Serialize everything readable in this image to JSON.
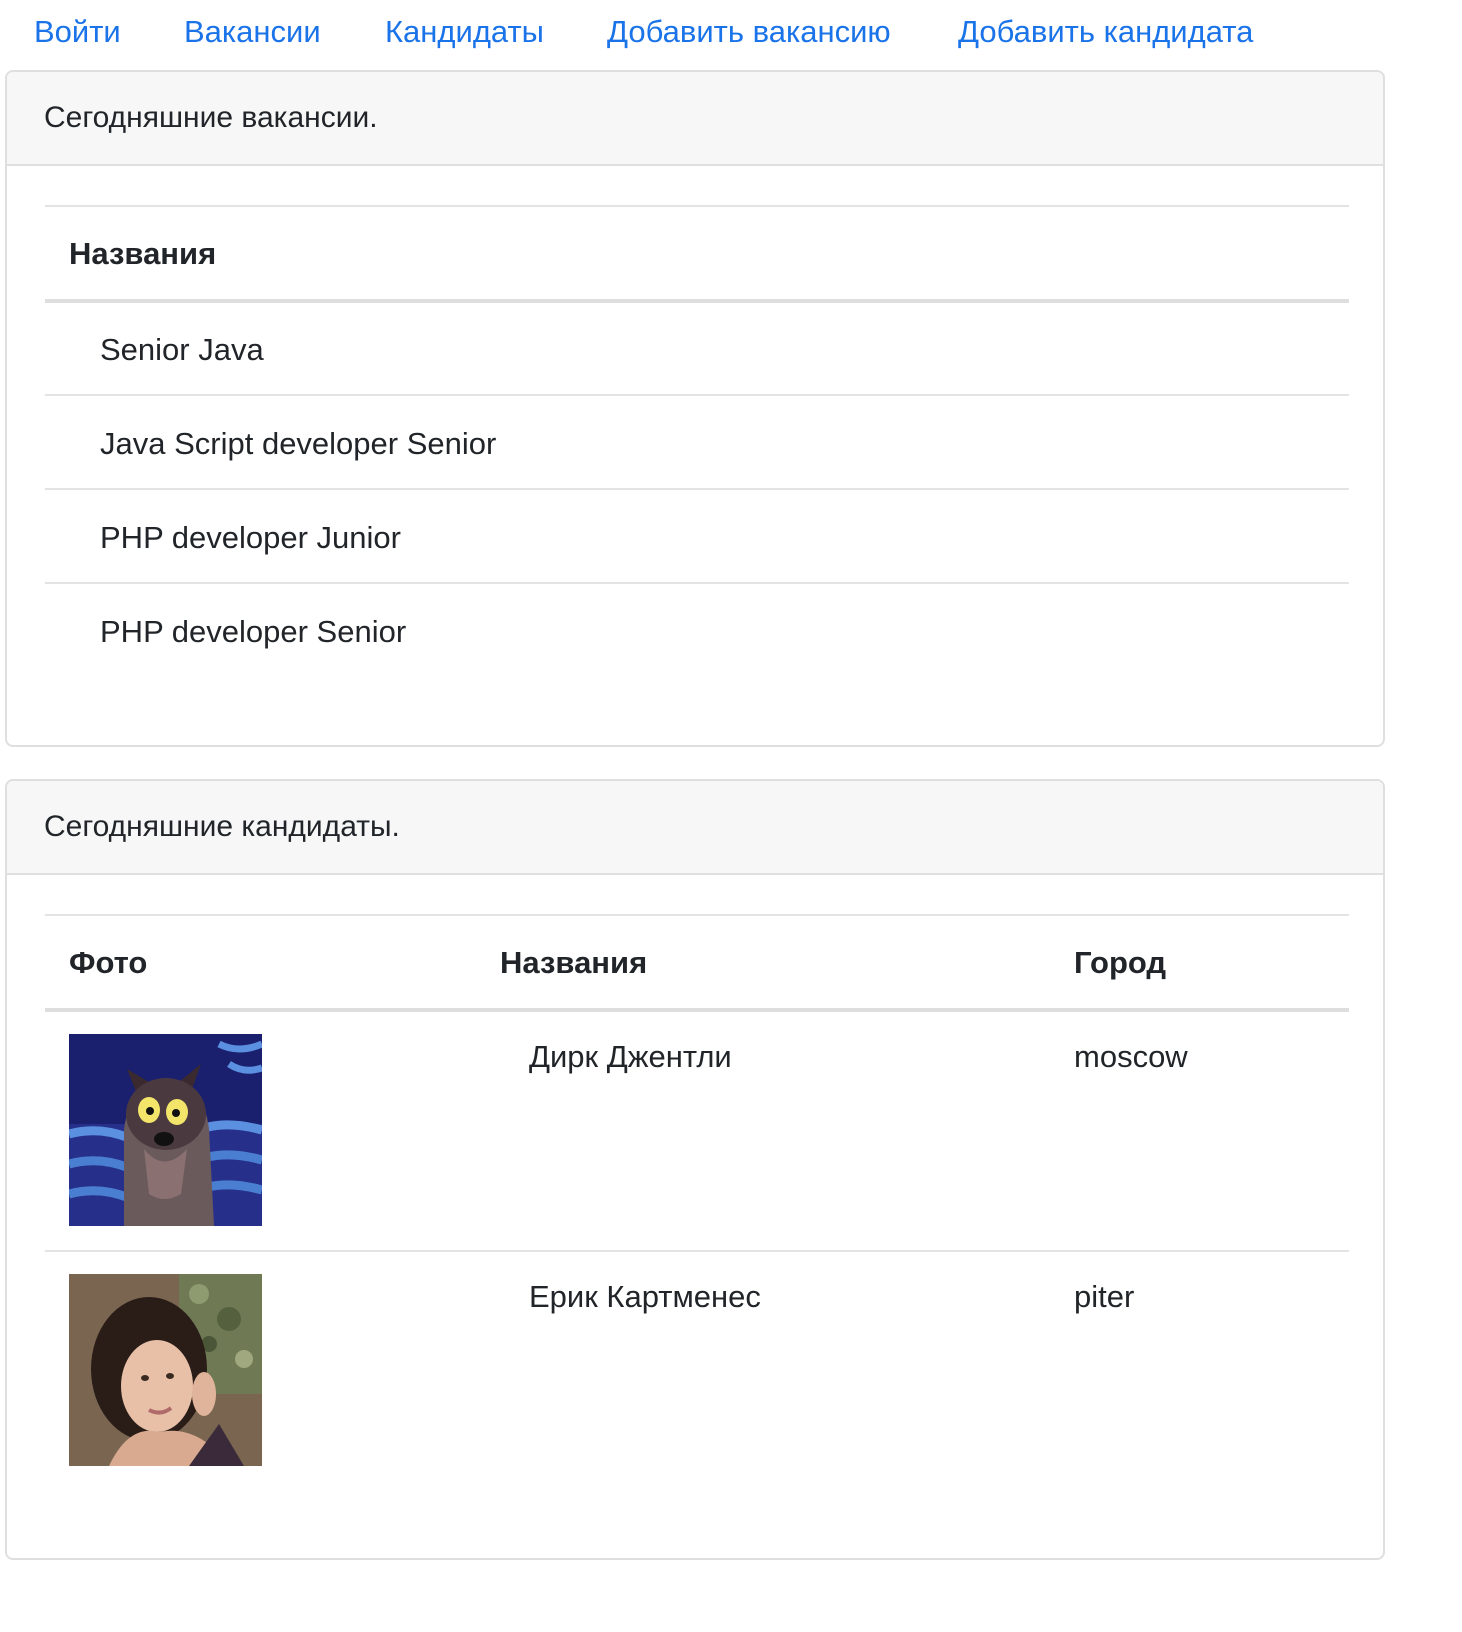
{
  "nav": {
    "items": [
      {
        "label": "Войти"
      },
      {
        "label": "Вакансии"
      },
      {
        "label": "Кандидаты"
      },
      {
        "label": "Добавить вакансию"
      },
      {
        "label": "Добавить кандидата"
      }
    ],
    "link_color": "#1a73e8"
  },
  "vacancies": {
    "title": "Сегодняшние вакансии.",
    "header": "Названия",
    "rows": [
      {
        "name": "Senior Java"
      },
      {
        "name": "Java Script developer Senior"
      },
      {
        "name": "PHP developer Junior"
      },
      {
        "name": "PHP developer Senior"
      }
    ]
  },
  "candidates": {
    "title": "Сегодняшние кандидаты.",
    "headers": {
      "photo": "Фото",
      "name": "Названия",
      "city": "Город"
    },
    "rows": [
      {
        "photo_icon": "cartoon-wolf-photo",
        "name": "Дирк Джентли",
        "city": "moscow"
      },
      {
        "photo_icon": "woman-portrait-photo",
        "name": "Ерик Картменес",
        "city": "piter"
      }
    ]
  }
}
